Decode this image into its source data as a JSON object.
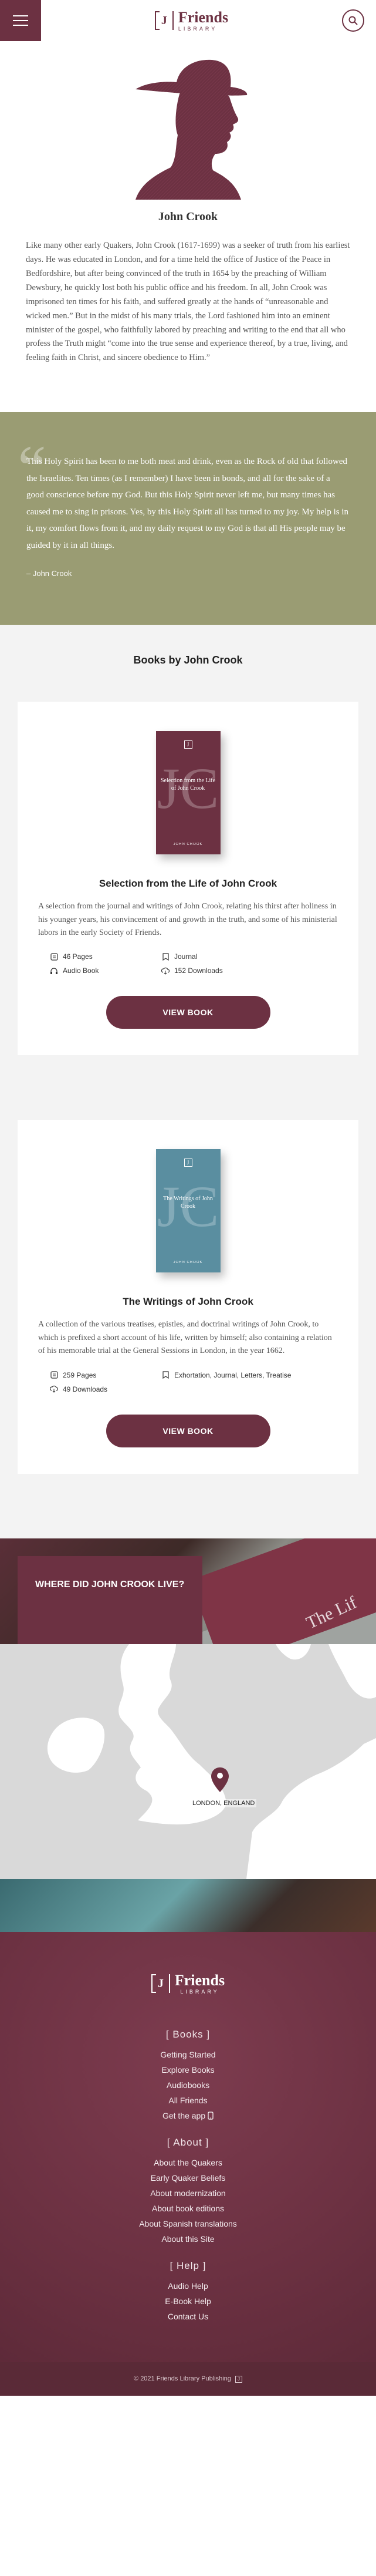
{
  "header": {
    "logo_big": "Friends",
    "logo_small": "LIBRARY",
    "logo_mark": "J"
  },
  "author": {
    "name": "John Crook",
    "bio": "Like many other early Quakers, John Crook (1617-1699) was a seeker of truth from his earliest days. He was educated in London, and for a time held the office of Justice of the Peace in Bedfordshire, but after being convinced of the truth in 1654 by the preaching of William Dewsbury, he quickly lost both his public office and his freedom. In all, John Crook was imprisoned ten times for his faith, and suffered greatly at the hands of “unreasonable and wicked men.” But in the midst of his many trials, the Lord fashioned him into an eminent minister of the gospel, who faithfully labored by preaching and writing to the end that all who profess the Truth might “come into the true sense and experience thereof, by a true, living, and feeling faith in Christ, and sincere obedience to Him.”"
  },
  "quote": {
    "mark": "“",
    "text": "This Holy Spirit has been to me both meat and drink, even as the Rock of old that followed the Israelites. Ten times (as I remember) I have been in bonds, and all for the sake of a good conscience before my God. But this Holy Spirit never left me, but many times has caused me to sing in prisons. Yes, by this Holy Spirit all has turned to my joy. My help is in it, my comfort flows from it, and my daily request to my God is that all His people may be guided by it in all things.",
    "attribution": "– John Crook"
  },
  "books": {
    "title": "Books by John Crook",
    "items": [
      {
        "cover_title": "Selection from the Life of John Crook",
        "cover_author": "JOHN CROOK",
        "cover_color": "#6c3142",
        "title": "Selection from the Life of John Crook",
        "description": "A selection from the journal and writings of John Crook, relating his thirst after holiness in his younger years, his convincement of and growth in the truth, and some of his ministerial labors in the early Society of Friends.",
        "pages": "46 Pages",
        "tags": "Journal",
        "extra": "Audio Book",
        "downloads": "152 Downloads",
        "button": "VIEW BOOK"
      },
      {
        "cover_title": "The Writings of John Crook",
        "cover_author": "JOHN CROOK",
        "cover_color": "#5a8ea0",
        "title": "The Writings of John Crook",
        "description": "A collection of the various treatises, epistles, and doctrinal writings of John Crook, to which is prefixed a short account of his life, written by himself; also containing a relation of his memorable trial at the General Sessions in London, in the year 1662.",
        "pages": "259 Pages",
        "tags": "Exhortation, Journal, Letters, Treatise",
        "downloads": "49 Downloads",
        "button": "VIEW BOOK"
      }
    ]
  },
  "map": {
    "heading": "WHERE DID JOHN CROOK LIVE?",
    "pin_label": "LONDON, ENGLAND",
    "banner_text": "The Lif"
  },
  "footer": {
    "sections": [
      {
        "title": "[ Books ]",
        "links": [
          "Getting Started",
          "Explore Books",
          "Audiobooks",
          "All Friends",
          "Get the app"
        ]
      },
      {
        "title": "[ About ]",
        "links": [
          "About the Quakers",
          "Early Quaker Beliefs",
          "About modernization",
          "About book editions",
          "About Spanish translations",
          "About this Site"
        ]
      },
      {
        "title": "[ Help ]",
        "links": [
          "Audio Help",
          "E-Book Help",
          "Contact Us"
        ]
      }
    ],
    "copyright": "© 2021 Friends Library Publishing"
  },
  "colors": {
    "brand": "#6c3142",
    "quote_bg": "#9a9c73"
  }
}
